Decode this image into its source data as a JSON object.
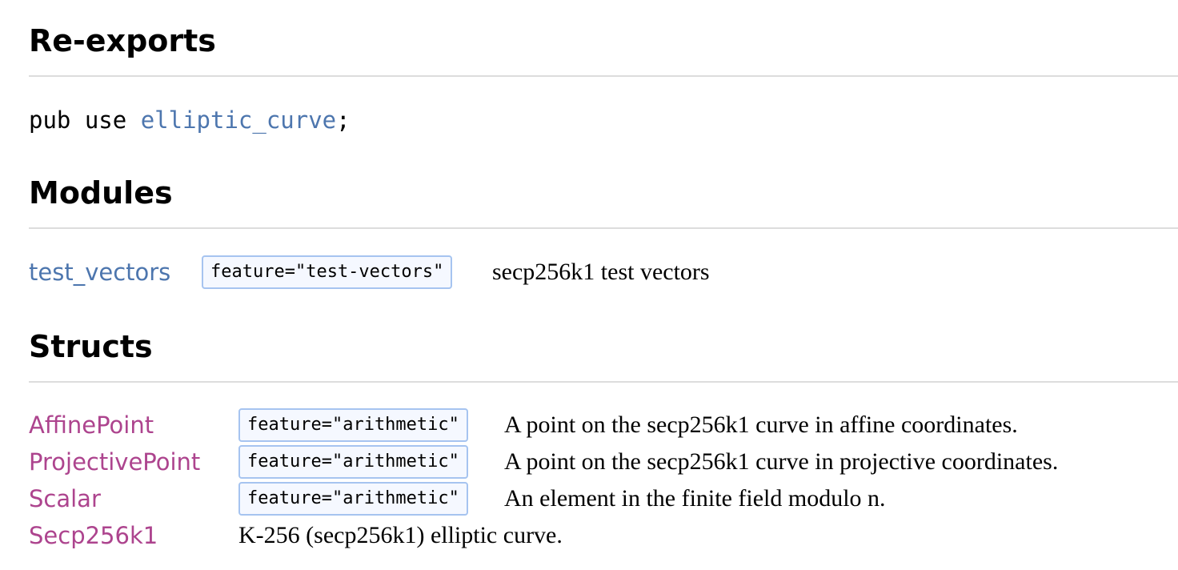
{
  "reexports": {
    "heading": "Re-exports",
    "keyword": "pub use ",
    "module": "elliptic_curve",
    "terminator": ";"
  },
  "modules": {
    "heading": "Modules",
    "items": [
      {
        "name": "test_vectors",
        "feature": "feature=\"test-vectors\"",
        "description": "secp256k1 test vectors"
      }
    ]
  },
  "structs": {
    "heading": "Structs",
    "items": [
      {
        "name": "AffinePoint",
        "feature": "feature=\"arithmetic\"",
        "description": "A point on the secp256k1 curve in affine coordinates."
      },
      {
        "name": "ProjectivePoint",
        "feature": "feature=\"arithmetic\"",
        "description": "A point on the secp256k1 curve in projective coordinates."
      },
      {
        "name": "Scalar",
        "feature": "feature=\"arithmetic\"",
        "description": "An element in the finite field modulo n."
      },
      {
        "name": "Secp256k1",
        "feature": "",
        "description": "K-256 (secp256k1) elliptic curve."
      }
    ]
  },
  "colors": {
    "module_link": "#4d76ae",
    "struct_link": "#ad448e",
    "feature_border": "#a6c4f0",
    "feature_bg": "#f5f8ff",
    "divider": "#dddddd"
  }
}
